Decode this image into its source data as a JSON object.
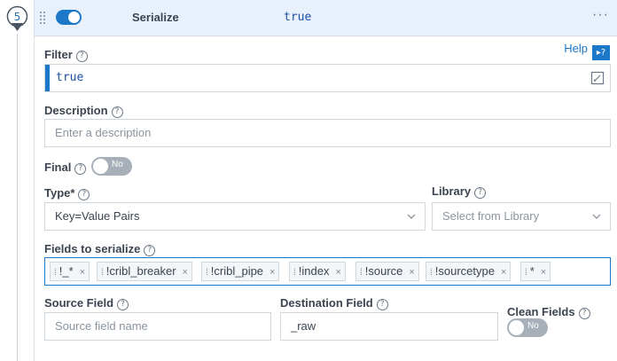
{
  "step": {
    "number": "5"
  },
  "header": {
    "function_name": "Serialize",
    "filter_value": "true",
    "enabled": true,
    "more_label": "···"
  },
  "help": {
    "label": "Help",
    "icon": "help-book-icon",
    "icon_glyph": "▸?"
  },
  "filter": {
    "label": "Filter",
    "value": "true"
  },
  "description": {
    "label": "Description",
    "placeholder": "Enter a description"
  },
  "final": {
    "label": "Final",
    "toggle_label": "No"
  },
  "type": {
    "label": "Type*",
    "value": "Key=Value Pairs"
  },
  "library": {
    "label": "Library",
    "placeholder": "Select from Library"
  },
  "fields": {
    "label": "Fields to serialize",
    "tags": [
      "!_*",
      "!cribl_breaker",
      "!cribl_pipe",
      "!index",
      "!source",
      "!sourcetype",
      "*"
    ]
  },
  "source_field": {
    "label": "Source Field",
    "placeholder": "Source field name"
  },
  "destination_field": {
    "label": "Destination Field",
    "value": "_raw"
  },
  "clean_fields": {
    "label": "Clean Fields",
    "toggle_label": "No"
  },
  "help_mark": "?",
  "tag_remove": "×",
  "tag_grip": "⁞",
  "colors": {
    "accent": "#1c78c9",
    "header_bg": "#e8f1fb",
    "toggle_off": "#a7b0b9"
  }
}
